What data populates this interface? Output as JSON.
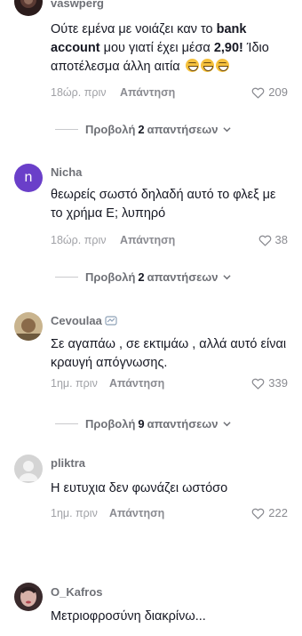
{
  "comments": [
    {
      "username": "vaswperg",
      "text_parts": {
        "a": "Ούτε εμένα με νοιάζει καν το ",
        "b1": "bank account",
        "c": " μου γιατί έχει μέσα ",
        "b2": "2,90!",
        "d": " Ίδιο αποτέλεσμα άλλη αιτία"
      },
      "time": "18ώρ. πριν",
      "reply_label": "Απάντηση",
      "likes": "209",
      "view_replies": {
        "prefix": "Προβολή ",
        "count": "2",
        "suffix": " απαντήσεων"
      }
    },
    {
      "username": "Nicha",
      "avatar_letter": "n",
      "text": "θεωρείς σωστό δηλαδή αυτό το φλεξ με το χρήμα Ε; λυπηρό",
      "time": "18ώρ. πριν",
      "reply_label": "Απάντηση",
      "likes": "38",
      "view_replies": {
        "prefix": "Προβολή ",
        "count": "2",
        "suffix": " απαντήσεων"
      }
    },
    {
      "username": "Cevoulaa",
      "text": "Σε αγαπάω , σε εκτιμάω , αλλά αυτό είναι κραυγή απόγνωσης.",
      "time": "1ημ. πριν",
      "reply_label": "Απάντηση",
      "likes": "339",
      "view_replies": {
        "prefix": "Προβολή ",
        "count": "9",
        "suffix": " απαντήσεων"
      }
    },
    {
      "username": "pliktra",
      "text": "Η ευτυχια δεν φωνάζει ωστόσο",
      "time": "1ημ. πριν",
      "reply_label": "Απάντηση",
      "likes": "222"
    },
    {
      "username": "O_Kafros",
      "text": "Μετριοφροσύνη διακρίνω..."
    }
  ],
  "colors": {
    "accent_avatar": "#6a3fc9",
    "text": "#161823",
    "muted": "#a1a2a7"
  },
  "icons": {
    "like": "heart-outline-icon",
    "expand": "chevron-down-icon"
  }
}
